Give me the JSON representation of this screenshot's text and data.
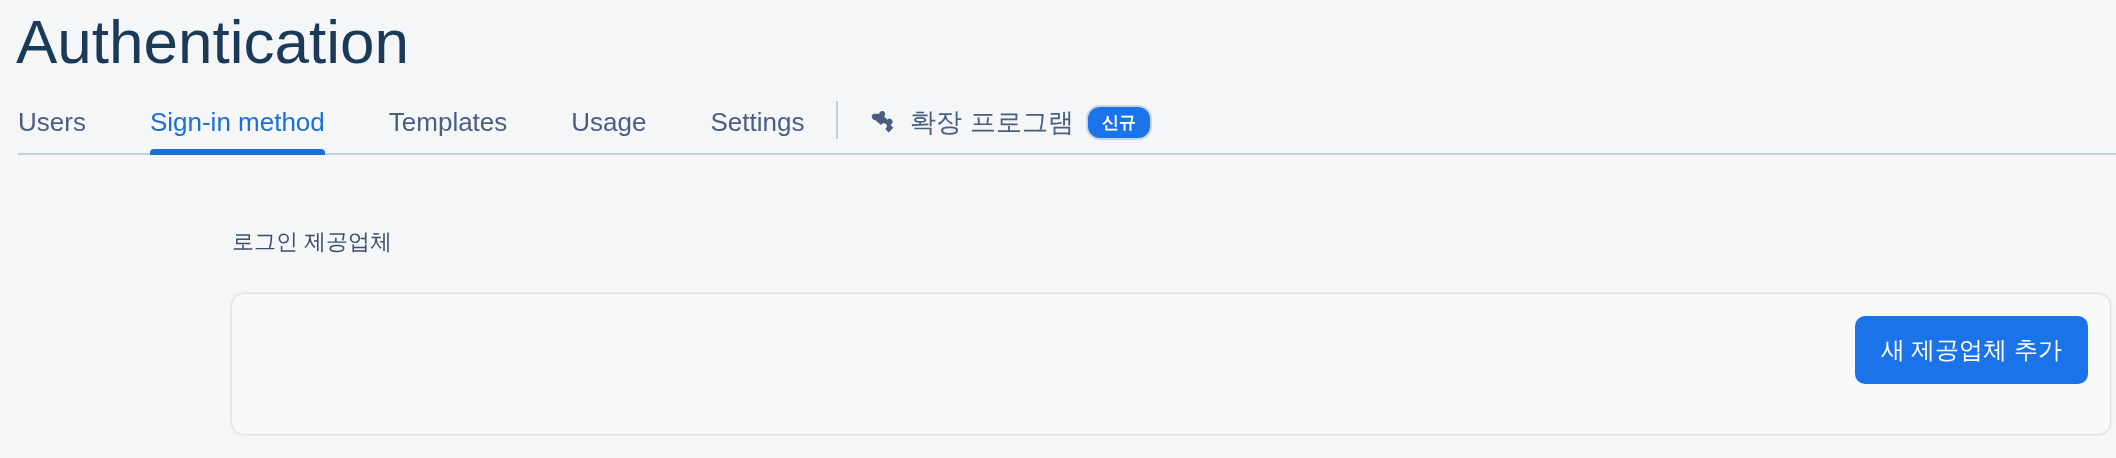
{
  "page_title": "Authentication",
  "tabs": [
    {
      "label": "Users",
      "selected": false
    },
    {
      "label": "Sign-in method",
      "selected": true
    },
    {
      "label": "Templates",
      "selected": false
    },
    {
      "label": "Usage",
      "selected": false
    },
    {
      "label": "Settings",
      "selected": false
    }
  ],
  "extensions_tab": {
    "label": "확장 프로그램",
    "badge": "신규",
    "selected": false
  },
  "section_title": "로그인 제공업체",
  "providers_card": {
    "add_button": "새 제공업체 추가"
  }
}
